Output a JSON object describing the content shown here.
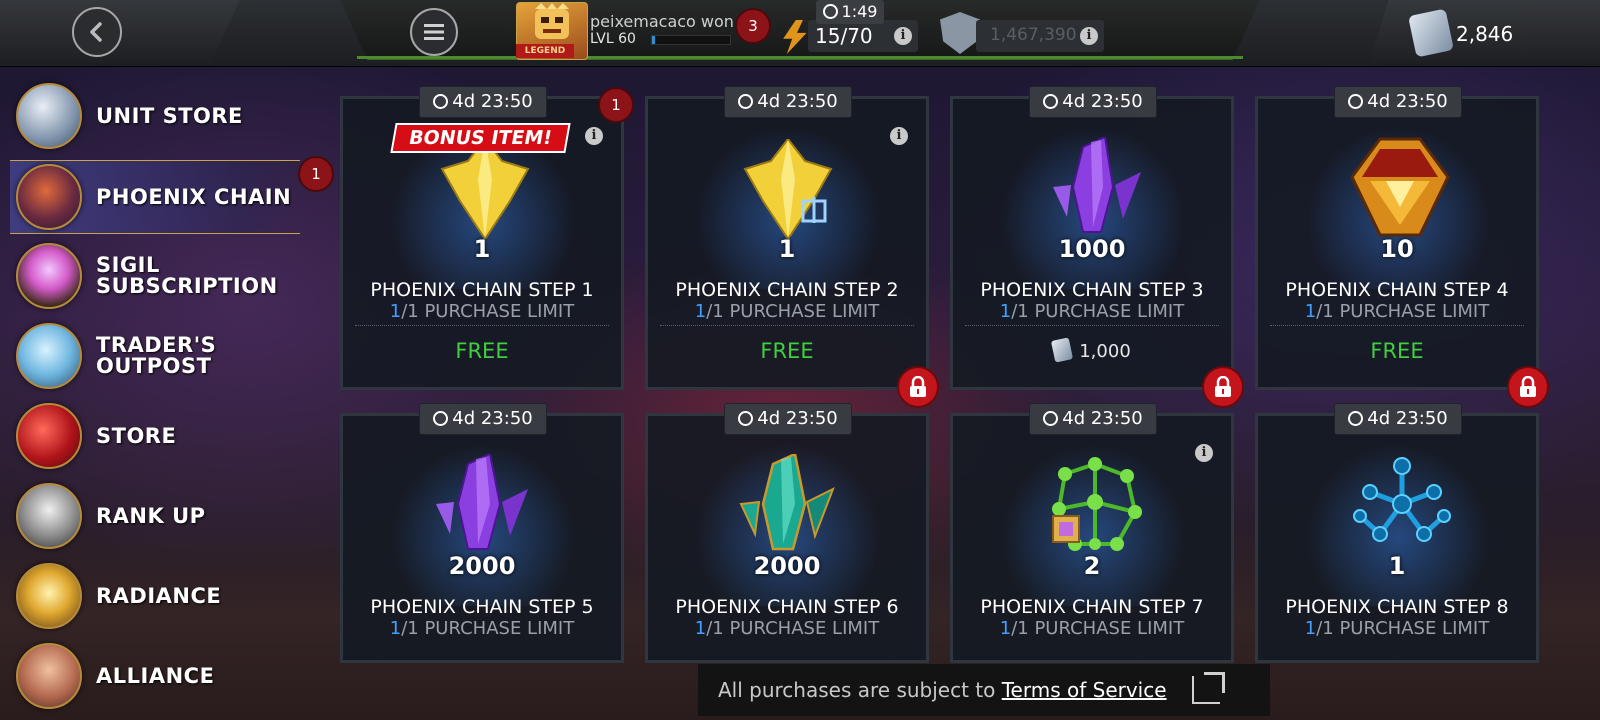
{
  "topbar": {
    "player_name": "peixemacaco won",
    "player_level": "LVL 60",
    "legend_tag": "LEGEND",
    "notification_count": "3",
    "energy_timer": "1:49",
    "energy": "15/70",
    "shield_points": "1,467,390",
    "units": "2,846",
    "xp_progress": 0.04
  },
  "sidebar": {
    "items": [
      {
        "label": "UNIT STORE",
        "icon": "unit-crystal-icon"
      },
      {
        "label": "PHOENIX CHAIN",
        "icon": "phoenix-hero-icon",
        "badge": "1",
        "active": true
      },
      {
        "label": "SIGIL\nSUBSCRIPTION",
        "icon": "sigil-icon"
      },
      {
        "label": "TRADER'S\nOUTPOST",
        "icon": "diamond-crystal-icon"
      },
      {
        "label": "STORE",
        "icon": "store-orb-icon"
      },
      {
        "label": "RANK UP",
        "icon": "rank-up-arrow-icon"
      },
      {
        "label": "RADIANCE",
        "icon": "radiance-orb-icon"
      },
      {
        "label": "ALLIANCE",
        "icon": "alliance-shield-icon"
      }
    ]
  },
  "cards": [
    {
      "timer": "4d 23:50",
      "qty": "1",
      "title": "PHOENIX CHAIN STEP 1",
      "limit_current": "1",
      "limit_text": "/1 PURCHASE LIMIT",
      "price": "FREE",
      "bonus": "BONUS ITEM!",
      "badge": "1",
      "icon": "gold-crystal-icon"
    },
    {
      "timer": "4d 23:50",
      "qty": "1",
      "title": "PHOENIX CHAIN STEP 2",
      "limit_current": "1",
      "limit_text": "/1 PURCHASE LIMIT",
      "price": "FREE",
      "icon": "gold-crystal-gift-icon"
    },
    {
      "timer": "4d 23:50",
      "qty": "1000",
      "title": "PHOENIX CHAIN STEP 3",
      "limit_current": "1",
      "limit_text": "/1 PURCHASE LIMIT",
      "price": "1,000",
      "icon": "purple-shard-icon"
    },
    {
      "timer": "4d 23:50",
      "qty": "10",
      "title": "PHOENIX CHAIN STEP 4",
      "limit_current": "1",
      "limit_text": "/1 PURCHASE LIMIT",
      "price": "FREE",
      "icon": "gold-sigil-gem-icon"
    },
    {
      "timer": "4d 23:50",
      "qty": "2000",
      "title": "PHOENIX CHAIN STEP 5",
      "limit_current": "1",
      "limit_text": "/1 PURCHASE LIMIT",
      "icon": "purple-shard-icon"
    },
    {
      "timer": "4d 23:50",
      "qty": "2000",
      "title": "PHOENIX CHAIN STEP 6",
      "limit_current": "1",
      "limit_text": "/1 PURCHASE LIMIT",
      "icon": "teal-shard-icon"
    },
    {
      "timer": "4d 23:50",
      "qty": "2",
      "title": "PHOENIX CHAIN STEP 7",
      "limit_current": "1",
      "limit_text": "/1 PURCHASE LIMIT",
      "icon": "green-catalyst-icon"
    },
    {
      "timer": "4d 23:50",
      "qty": "1",
      "title": "PHOENIX CHAIN STEP 8",
      "limit_current": "1",
      "limit_text": "/1 PURCHASE LIMIT",
      "icon": "blue-catalyst-icon"
    }
  ],
  "footer": {
    "prefix": "All purchases are subject to ",
    "link": "Terms of Service"
  },
  "colors": {
    "free": "#3fcf3f",
    "limit_highlight": "#3fa0ff",
    "lock": "#c3151b",
    "bonus": "#d60d15",
    "badge": "#8c1419"
  }
}
